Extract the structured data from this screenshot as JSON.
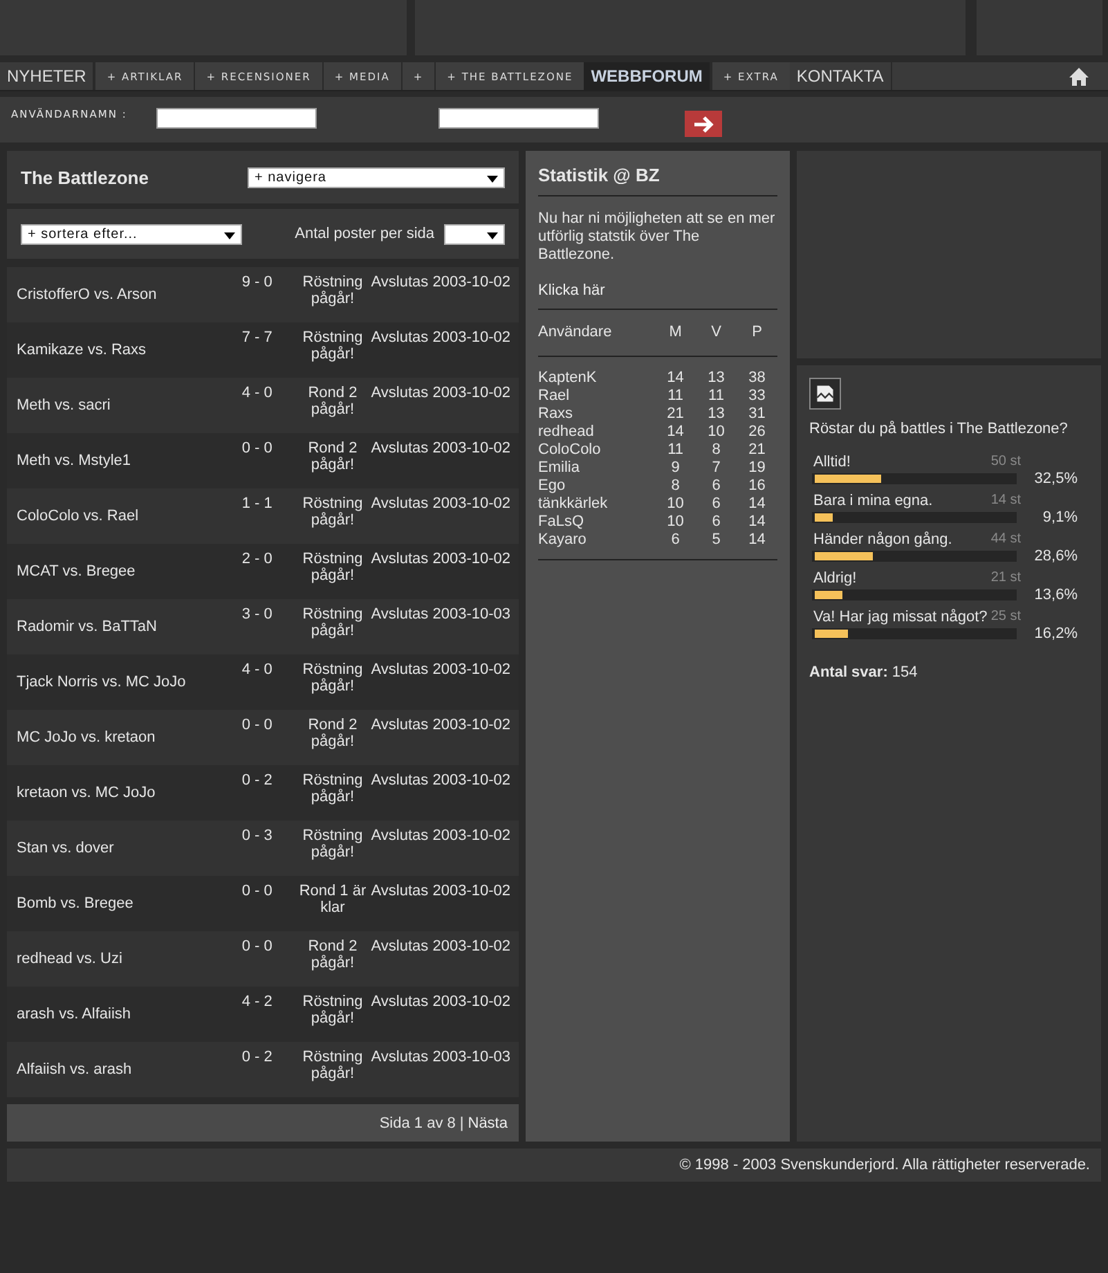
{
  "nav": [
    {
      "label": "NYHETER",
      "kind": "plain",
      "selected": false
    },
    {
      "label": "+ ARTIKLAR",
      "kind": "boxed",
      "selected": false
    },
    {
      "label": "+ RECENSIONER",
      "kind": "boxed",
      "selected": false
    },
    {
      "label": "+ MEDIA",
      "kind": "boxed",
      "selected": false
    },
    {
      "label": "+",
      "kind": "boxed",
      "selected": false
    },
    {
      "label": "+ THE BATTLEZONE",
      "kind": "boxed",
      "selected": false
    },
    {
      "label": "WEBBFORUM",
      "kind": "plain",
      "selected": true
    },
    {
      "label": "+ EXTRA",
      "kind": "boxed",
      "selected": false
    },
    {
      "label": "KONTAKTA",
      "kind": "plain",
      "selected": false
    }
  ],
  "login": {
    "username_label": "ANVÄNDARNAMN :"
  },
  "battles": {
    "title": "The Battlezone",
    "navigate": "+ navigera",
    "sort": "+ sortera efter...",
    "per_page_label": "Antal poster per sida",
    "rows": [
      {
        "name": "CristofferO vs. Arson",
        "score": "9 - 0",
        "status": "Röstning pågår!",
        "ends": "Avslutas 2003-10-02"
      },
      {
        "name": "Kamikaze vs. Raxs",
        "score": "7 - 7",
        "status": "Röstning pågår!",
        "ends": "Avslutas 2003-10-02"
      },
      {
        "name": "Meth vs. sacri",
        "score": "4 - 0",
        "status": "Rond 2 pågår!",
        "ends": "Avslutas 2003-10-02"
      },
      {
        "name": "Meth vs. Mstyle1",
        "score": "0 - 0",
        "status": "Rond 2 pågår!",
        "ends": "Avslutas 2003-10-02"
      },
      {
        "name": "ColoColo vs. Rael",
        "score": "1 - 1",
        "status": "Röstning pågår!",
        "ends": "Avslutas 2003-10-02"
      },
      {
        "name": "MCAT vs. Bregee",
        "score": "2 - 0",
        "status": "Röstning pågår!",
        "ends": "Avslutas 2003-10-02"
      },
      {
        "name": "Radomir vs. BaTTaN",
        "score": "3 - 0",
        "status": "Röstning pågår!",
        "ends": "Avslutas 2003-10-03"
      },
      {
        "name": "Tjack Norris vs. MC JoJo",
        "score": "4 - 0",
        "status": "Röstning pågår!",
        "ends": "Avslutas 2003-10-02"
      },
      {
        "name": "MC JoJo vs. kretaon",
        "score": "0 - 0",
        "status": "Rond 2 pågår!",
        "ends": "Avslutas 2003-10-02"
      },
      {
        "name": "kretaon vs. MC JoJo",
        "score": "0 - 2",
        "status": "Röstning pågår!",
        "ends": "Avslutas 2003-10-02"
      },
      {
        "name": "Stan vs. dover",
        "score": "0 - 3",
        "status": "Röstning pågår!",
        "ends": "Avslutas 2003-10-02"
      },
      {
        "name": "Bomb vs. Bregee",
        "score": "0 - 0",
        "status": "Rond 1 är klar",
        "ends": "Avslutas 2003-10-02"
      },
      {
        "name": "redhead vs. Uzi",
        "score": "0 - 0",
        "status": "Rond 2 pågår!",
        "ends": "Avslutas 2003-10-02"
      },
      {
        "name": "arash vs. Alfaiish",
        "score": "4 - 2",
        "status": "Röstning pågår!",
        "ends": "Avslutas 2003-10-02"
      },
      {
        "name": "Alfaiish vs. arash",
        "score": "0 - 2",
        "status": "Röstning pågår!",
        "ends": "Avslutas 2003-10-03"
      }
    ],
    "page_info": "Sida 1 av 8",
    "separator": "|",
    "next": "Nästa"
  },
  "stats": {
    "title": "Statistik @ BZ",
    "intro": "Nu har ni möjligheten att se en mer utförlig statstik över The Battlezone.",
    "link": "Klicka här",
    "columns": [
      "Användare",
      "M",
      "V",
      "P"
    ],
    "rows": [
      [
        "KaptenK",
        "14",
        "13",
        "38"
      ],
      [
        "Rael",
        "11",
        "11",
        "33"
      ],
      [
        "Raxs",
        "21",
        "13",
        "31"
      ],
      [
        "redhead",
        "14",
        "10",
        "26"
      ],
      [
        "ColoColo",
        "11",
        "8",
        "21"
      ],
      [
        "Emilia",
        "9",
        "7",
        "19"
      ],
      [
        "Ego",
        "8",
        "6",
        "16"
      ],
      [
        "tänkkärlek",
        "10",
        "6",
        "14"
      ],
      [
        "FaLsQ",
        "10",
        "6",
        "14"
      ],
      [
        "Kayaro",
        "6",
        "5",
        "14"
      ]
    ]
  },
  "poll": {
    "question": "Röstar du på battles i The Battlezone?",
    "options": [
      {
        "label": "Alltid!",
        "count": "50 st",
        "level": 0.325,
        "percent": "32,5%"
      },
      {
        "label": "Bara i mina egna.",
        "count": "14 st",
        "level": 0.091,
        "percent": "9,1%"
      },
      {
        "label": "Händer någon gång.",
        "count": "44 st",
        "level": 0.286,
        "percent": "28,6%"
      },
      {
        "label": "Aldrig!",
        "count": "21 st",
        "level": 0.136,
        "percent": "13,6%"
      },
      {
        "label": "Va! Har jag missat något?",
        "count": "25 st",
        "level": 0.162,
        "percent": "16,2%"
      }
    ],
    "total_label": "Antal svar:",
    "total": "154"
  },
  "footer": "© 1998 - 2003 Svenskunderjord. Alla rättigheter reserverade."
}
